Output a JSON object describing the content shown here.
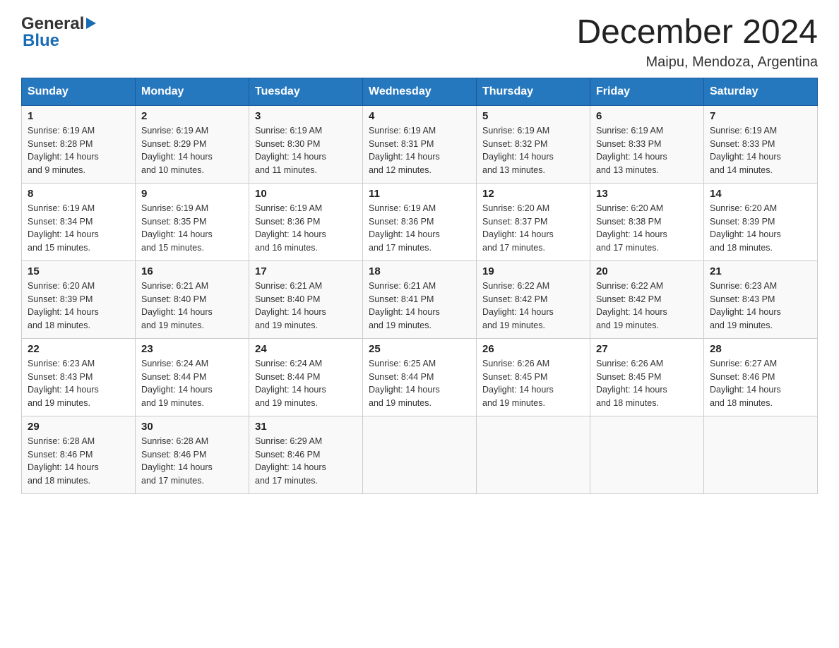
{
  "header": {
    "logo_general": "General",
    "logo_blue": "Blue",
    "month_title": "December 2024",
    "location": "Maipu, Mendoza, Argentina"
  },
  "days_of_week": [
    "Sunday",
    "Monday",
    "Tuesday",
    "Wednesday",
    "Thursday",
    "Friday",
    "Saturday"
  ],
  "weeks": [
    [
      {
        "day": "1",
        "sunrise": "6:19 AM",
        "sunset": "8:28 PM",
        "daylight": "14 hours and 9 minutes."
      },
      {
        "day": "2",
        "sunrise": "6:19 AM",
        "sunset": "8:29 PM",
        "daylight": "14 hours and 10 minutes."
      },
      {
        "day": "3",
        "sunrise": "6:19 AM",
        "sunset": "8:30 PM",
        "daylight": "14 hours and 11 minutes."
      },
      {
        "day": "4",
        "sunrise": "6:19 AM",
        "sunset": "8:31 PM",
        "daylight": "14 hours and 12 minutes."
      },
      {
        "day": "5",
        "sunrise": "6:19 AM",
        "sunset": "8:32 PM",
        "daylight": "14 hours and 13 minutes."
      },
      {
        "day": "6",
        "sunrise": "6:19 AM",
        "sunset": "8:33 PM",
        "daylight": "14 hours and 13 minutes."
      },
      {
        "day": "7",
        "sunrise": "6:19 AM",
        "sunset": "8:33 PM",
        "daylight": "14 hours and 14 minutes."
      }
    ],
    [
      {
        "day": "8",
        "sunrise": "6:19 AM",
        "sunset": "8:34 PM",
        "daylight": "14 hours and 15 minutes."
      },
      {
        "day": "9",
        "sunrise": "6:19 AM",
        "sunset": "8:35 PM",
        "daylight": "14 hours and 15 minutes."
      },
      {
        "day": "10",
        "sunrise": "6:19 AM",
        "sunset": "8:36 PM",
        "daylight": "14 hours and 16 minutes."
      },
      {
        "day": "11",
        "sunrise": "6:19 AM",
        "sunset": "8:36 PM",
        "daylight": "14 hours and 17 minutes."
      },
      {
        "day": "12",
        "sunrise": "6:20 AM",
        "sunset": "8:37 PM",
        "daylight": "14 hours and 17 minutes."
      },
      {
        "day": "13",
        "sunrise": "6:20 AM",
        "sunset": "8:38 PM",
        "daylight": "14 hours and 17 minutes."
      },
      {
        "day": "14",
        "sunrise": "6:20 AM",
        "sunset": "8:39 PM",
        "daylight": "14 hours and 18 minutes."
      }
    ],
    [
      {
        "day": "15",
        "sunrise": "6:20 AM",
        "sunset": "8:39 PM",
        "daylight": "14 hours and 18 minutes."
      },
      {
        "day": "16",
        "sunrise": "6:21 AM",
        "sunset": "8:40 PM",
        "daylight": "14 hours and 19 minutes."
      },
      {
        "day": "17",
        "sunrise": "6:21 AM",
        "sunset": "8:40 PM",
        "daylight": "14 hours and 19 minutes."
      },
      {
        "day": "18",
        "sunrise": "6:21 AM",
        "sunset": "8:41 PM",
        "daylight": "14 hours and 19 minutes."
      },
      {
        "day": "19",
        "sunrise": "6:22 AM",
        "sunset": "8:42 PM",
        "daylight": "14 hours and 19 minutes."
      },
      {
        "day": "20",
        "sunrise": "6:22 AM",
        "sunset": "8:42 PM",
        "daylight": "14 hours and 19 minutes."
      },
      {
        "day": "21",
        "sunrise": "6:23 AM",
        "sunset": "8:43 PM",
        "daylight": "14 hours and 19 minutes."
      }
    ],
    [
      {
        "day": "22",
        "sunrise": "6:23 AM",
        "sunset": "8:43 PM",
        "daylight": "14 hours and 19 minutes."
      },
      {
        "day": "23",
        "sunrise": "6:24 AM",
        "sunset": "8:44 PM",
        "daylight": "14 hours and 19 minutes."
      },
      {
        "day": "24",
        "sunrise": "6:24 AM",
        "sunset": "8:44 PM",
        "daylight": "14 hours and 19 minutes."
      },
      {
        "day": "25",
        "sunrise": "6:25 AM",
        "sunset": "8:44 PM",
        "daylight": "14 hours and 19 minutes."
      },
      {
        "day": "26",
        "sunrise": "6:26 AM",
        "sunset": "8:45 PM",
        "daylight": "14 hours and 19 minutes."
      },
      {
        "day": "27",
        "sunrise": "6:26 AM",
        "sunset": "8:45 PM",
        "daylight": "14 hours and 18 minutes."
      },
      {
        "day": "28",
        "sunrise": "6:27 AM",
        "sunset": "8:46 PM",
        "daylight": "14 hours and 18 minutes."
      }
    ],
    [
      {
        "day": "29",
        "sunrise": "6:28 AM",
        "sunset": "8:46 PM",
        "daylight": "14 hours and 18 minutes."
      },
      {
        "day": "30",
        "sunrise": "6:28 AM",
        "sunset": "8:46 PM",
        "daylight": "14 hours and 17 minutes."
      },
      {
        "day": "31",
        "sunrise": "6:29 AM",
        "sunset": "8:46 PM",
        "daylight": "14 hours and 17 minutes."
      },
      null,
      null,
      null,
      null
    ]
  ],
  "labels": {
    "sunrise": "Sunrise:",
    "sunset": "Sunset:",
    "daylight": "Daylight:"
  }
}
